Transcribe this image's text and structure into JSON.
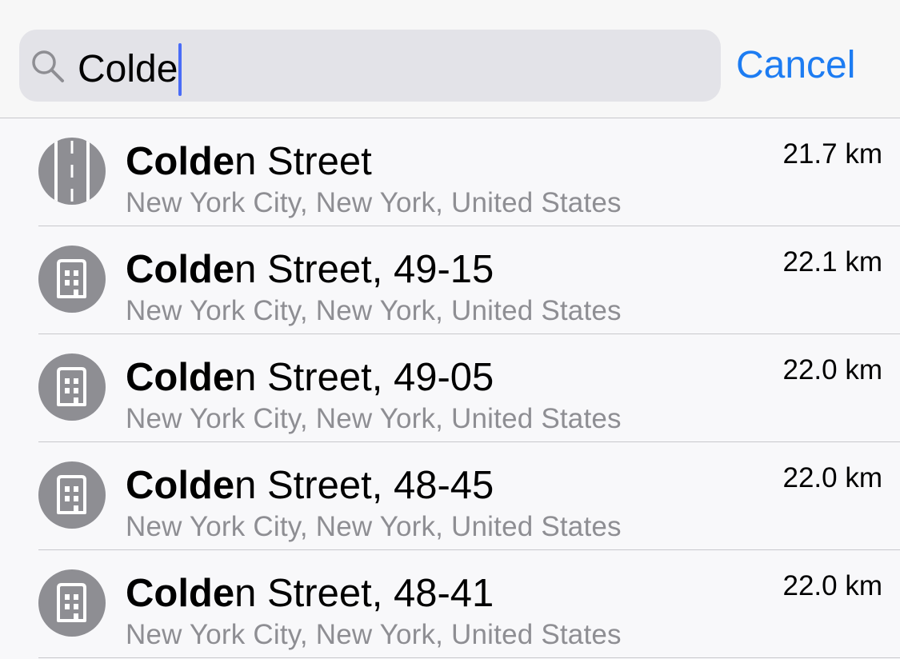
{
  "search": {
    "query": "Colde",
    "cancel_label": "Cancel",
    "search_icon": "magnifying-glass"
  },
  "colors": {
    "accent": "#1d7cf2",
    "caret": "#4a6cf7",
    "icon_gray": "#8e8e93",
    "subtitle_gray": "#8e8e93"
  },
  "results": [
    {
      "icon": "road-icon",
      "title_match": "Colde",
      "title_rest": "n Street",
      "subtitle": "New York City, New York, United States",
      "distance": "21.7 km"
    },
    {
      "icon": "building-icon",
      "title_match": "Colde",
      "title_rest": "n Street, 49-15",
      "subtitle": "New York City, New York, United States",
      "distance": "22.1 km"
    },
    {
      "icon": "building-icon",
      "title_match": "Colde",
      "title_rest": "n Street, 49-05",
      "subtitle": "New York City, New York, United States",
      "distance": "22.0 km"
    },
    {
      "icon": "building-icon",
      "title_match": "Colde",
      "title_rest": "n Street, 48-45",
      "subtitle": "New York City, New York, United States",
      "distance": "22.0 km"
    },
    {
      "icon": "building-icon",
      "title_match": "Colde",
      "title_rest": "n Street, 48-41",
      "subtitle": "New York City, New York, United States",
      "distance": "22.0 km"
    }
  ]
}
